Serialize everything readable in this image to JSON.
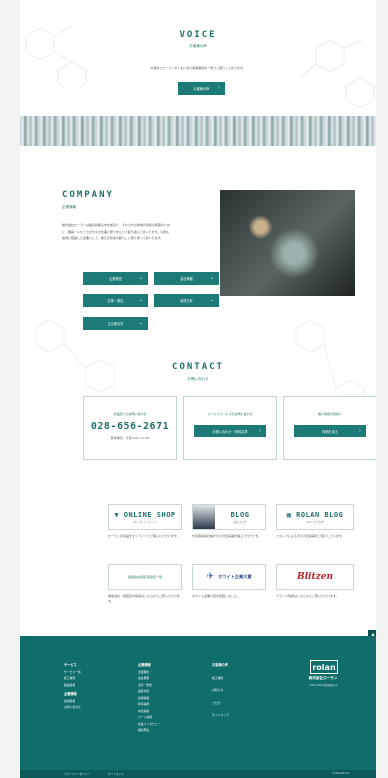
{
  "voice": {
    "title": "VOICE",
    "subtitle": "お客様の声",
    "description": "お客様とローランがともに歩む取組事例を一覧でご紹介しております。",
    "button": "お客様の声"
  },
  "company": {
    "title": "COMPANY",
    "subtitle": "企業情報",
    "description": "株式会社ローランは福島県郡山市を拠点に、それぞれの地域の皆様の笑顔のために、職員一人ひとりが日々の仕事に誇りをもって取り組んでまいります。今後も地域に根差した企業として、地元の皆様の暮らしに寄り添ってまいります。",
    "buttons": [
      "企業理念",
      "会社概要",
      "沿革・歴史",
      "品質方針",
      "主な取引先",
      "採用情報"
    ]
  },
  "contact": {
    "title": "CONTACT",
    "subtitle": "お問い合わせ",
    "phone_label": "お電話でのお問い合わせ",
    "phone": "028-656-2671",
    "hours": "受付時間：平日9:00~17:00",
    "form_label": "メールフォームでのお問い合わせ",
    "form_button": "お問い合わせ・資料請求",
    "privacy_label": "個人情報の取扱い",
    "privacy_button": "詳細を見る"
  },
  "banners": [
    {
      "main": "ONLINE SHOP",
      "sub": "オンラインショップ",
      "caption": "ローランの商品をオンラインでご購入いただけます。"
    },
    {
      "main": "BLOG",
      "sub": "社長ブログ",
      "caption": "代表取締役社長が日々の出来事を綴るブログです。"
    },
    {
      "main": "ROLAN BLOG",
      "sub": "スタッフブログ",
      "caption": "スタッフによる日々の出来事をご紹介しています。"
    },
    {
      "main": "関連会社情報 取扱店一覧",
      "sub": "",
      "caption": "関連会社・取扱店の情報はこちらからご覧いただけます。"
    },
    {
      "main": "ホワイト企業大賞",
      "sub": "",
      "caption": "ホワイト企業大賞を受賞しました。"
    },
    {
      "main": "Blitzen",
      "sub": "",
      "caption": "ブランド情報はこちらからご覧いただけます。"
    }
  ],
  "footer": {
    "col1": [
      "サービス",
      "サービス一覧",
      "施工事例",
      "製品情報",
      "店舗一覧",
      "リフォーム",
      "企業情報",
      "採用情報",
      "お問い合わせ"
    ],
    "col2": [
      "企業情報",
      "企業理念",
      "会社概要",
      "沿革・歴史",
      "品質方針",
      "採用情報",
      "新卒採用",
      "中途採用",
      "パート採用",
      "社員インタビュー",
      "福利厚生"
    ],
    "col3": [
      "お客様の声",
      "施工事例",
      "お知らせ",
      "ブログ",
      "個人情報",
      "サイトマップ"
    ],
    "company_name": "株式会社ローラン",
    "logo": "rolan",
    "address": "〒963-0000 福島県郡山市",
    "links": [
      "プライバシーポリシー",
      "サイトマップ"
    ],
    "copyright": "© ROLAN Inc."
  },
  "page_top": "▲"
}
